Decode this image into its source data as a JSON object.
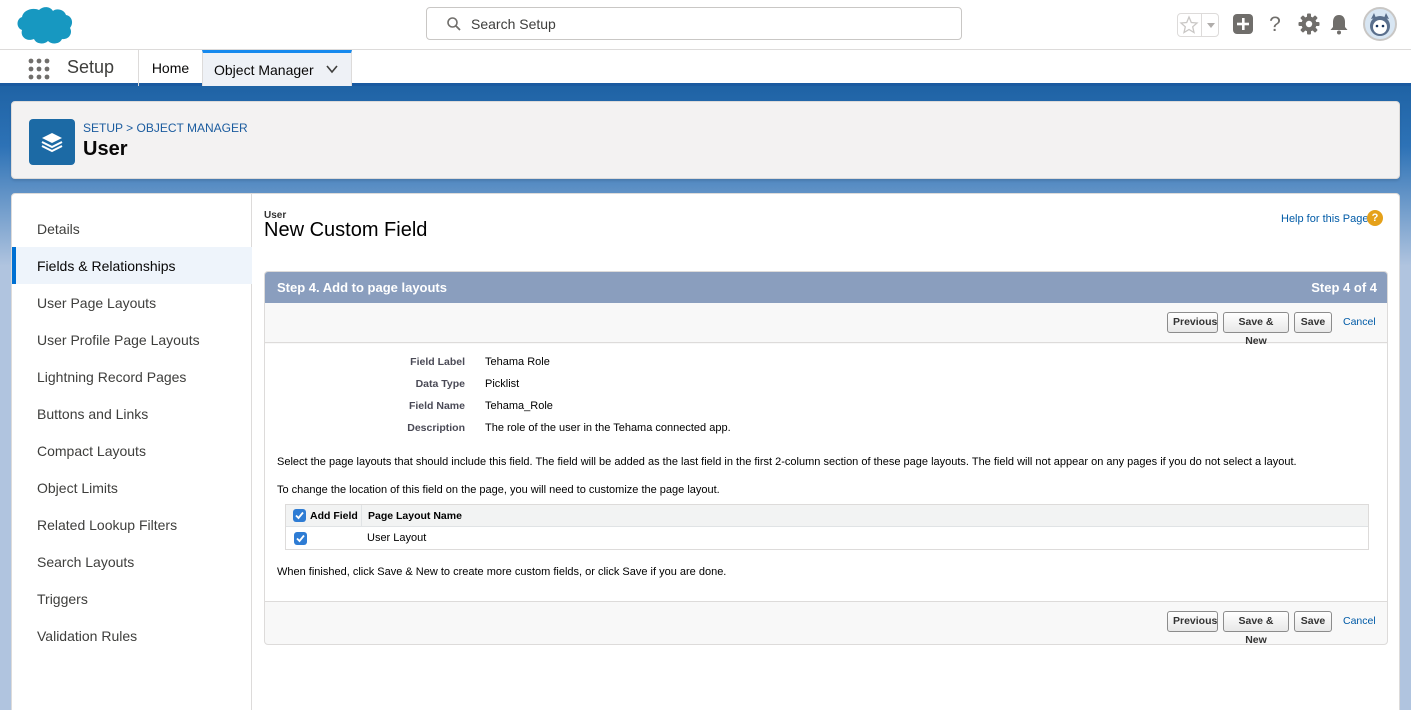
{
  "header": {
    "search_placeholder": "Search Setup",
    "icons": [
      "salesforce-cloud-logo",
      "star-icon",
      "chevron-down-icon",
      "plus-icon",
      "help-icon",
      "gear-icon",
      "bell-icon",
      "avatar"
    ]
  },
  "context_bar": {
    "app_name": "Setup",
    "tabs": [
      {
        "label": "Home"
      },
      {
        "label": "Object Manager"
      }
    ]
  },
  "page_header": {
    "breadcrumb": [
      "SETUP",
      "OBJECT MANAGER"
    ],
    "breadcrumb_sep": ">",
    "title": "User"
  },
  "sidebar": {
    "items": [
      {
        "label": "Details"
      },
      {
        "label": "Fields & Relationships"
      },
      {
        "label": "User Page Layouts"
      },
      {
        "label": "User Profile Page Layouts"
      },
      {
        "label": "Lightning Record Pages"
      },
      {
        "label": "Buttons and Links"
      },
      {
        "label": "Compact Layouts"
      },
      {
        "label": "Object Limits"
      },
      {
        "label": "Related Lookup Filters"
      },
      {
        "label": "Search Layouts"
      },
      {
        "label": "Triggers"
      },
      {
        "label": "Validation Rules"
      }
    ],
    "active_index": 1
  },
  "content": {
    "object_name": "User",
    "title": "New Custom Field",
    "help_link": "Help for this Page",
    "help_icon_glyph": "?",
    "step_title": "Step 4. Add to page layouts",
    "step_count": "Step 4 of 4",
    "buttons": {
      "previous": "Previous",
      "save_new": "Save & New",
      "save": "Save",
      "cancel": "Cancel"
    },
    "details": [
      {
        "label": "Field Label",
        "value": "Tehama Role"
      },
      {
        "label": "Data Type",
        "value": "Picklist"
      },
      {
        "label": "Field Name",
        "value": "Tehama_Role"
      },
      {
        "label": "Description",
        "value": "The role of the user in the Tehama connected app."
      }
    ],
    "instruction_1": "Select the page layouts that should include this field. The field will be added as the last field in the first 2-column section of these page layouts. The field will not appear on any pages if you do not select a layout.",
    "instruction_2": "To change the location of this field on the page, you will need to customize the page layout.",
    "table": {
      "columns": [
        "Add Field",
        "Page Layout Name"
      ],
      "rows": [
        {
          "checked": true,
          "name": "User Layout"
        }
      ]
    },
    "finish_text": "When finished, click Save & New to create more custom fields, or click Save if you are done."
  },
  "colors": {
    "brand_blue": "#1a5aa0",
    "step_bar": "#8a9ebe",
    "link": "#015ba7",
    "checkbox": "#2e7cd4"
  }
}
